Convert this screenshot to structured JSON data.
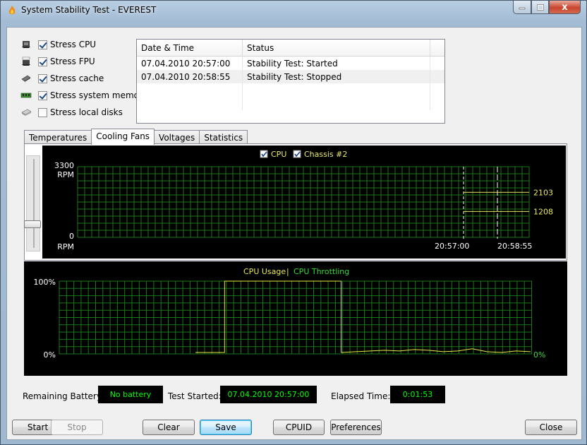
{
  "window": {
    "title": "System Stability Test - EVEREST",
    "close_glyph": "x"
  },
  "stress_options": [
    {
      "label": "Stress CPU",
      "checked": true,
      "icon": "cpu-icon"
    },
    {
      "label": "Stress FPU",
      "checked": true,
      "icon": "fpu-icon"
    },
    {
      "label": "Stress cache",
      "checked": true,
      "icon": "cache-icon"
    },
    {
      "label": "Stress system memory",
      "checked": true,
      "icon": "memory-icon"
    },
    {
      "label": "Stress local disks",
      "checked": false,
      "icon": "disk-icon"
    }
  ],
  "log": {
    "columns": [
      "Date & Time",
      "Status"
    ],
    "rows": [
      {
        "datetime": "07.04.2010 20:57:00",
        "status": "Stability Test: Started"
      },
      {
        "datetime": "07.04.2010 20:58:55",
        "status": "Stability Test: Stopped"
      }
    ]
  },
  "tabs": [
    {
      "label": "Temperatures",
      "active": false
    },
    {
      "label": "Cooling Fans",
      "active": true
    },
    {
      "label": "Voltages",
      "active": false
    },
    {
      "label": "Statistics",
      "active": false
    }
  ],
  "fan_chart": {
    "legend": [
      "CPU",
      "Chassis #2"
    ],
    "y_max_label": "3300",
    "y_min_label": "0",
    "unit": "RPM",
    "x_labels": [
      "20:57:00",
      "20:58:55"
    ],
    "value_labels": [
      "2103",
      "1208"
    ],
    "colors": {
      "grid": "#1a7a1a",
      "line": "#e8e86a",
      "text": "#ffffff",
      "value": "#e8e86a"
    }
  },
  "cpu_chart": {
    "legend_usage": "CPU Usage",
    "legend_sep": "|",
    "legend_throttling": "CPU Throttling",
    "y_max_label": "100%",
    "y_min_label": "0%",
    "throttle_value_label": "0%",
    "colors": {
      "grid": "#1a7a1a",
      "usage": "#e8e84a",
      "throttling": "#39d839"
    }
  },
  "chart_data": [
    {
      "type": "line",
      "title": "",
      "ylabel": "RPM",
      "ylim": [
        0,
        3300
      ],
      "x": [
        "20:57:00",
        "20:58:55"
      ],
      "series": [
        {
          "name": "CPU",
          "values": [
            2103,
            2103
          ]
        },
        {
          "name": "Chassis #2",
          "values": [
            1208,
            1208
          ]
        }
      ]
    },
    {
      "type": "line",
      "title": "",
      "ylim": [
        0,
        100
      ],
      "series": [
        {
          "name": "CPU Usage",
          "values": [
            2,
            2,
            100,
            100,
            100,
            100,
            100,
            100,
            100,
            100,
            2,
            3,
            4,
            5,
            4,
            6,
            5,
            3,
            4,
            7,
            3,
            2,
            4,
            3
          ]
        },
        {
          "name": "CPU Throttling",
          "values": [
            0,
            0,
            0,
            0,
            0,
            0,
            0,
            0,
            0,
            0,
            0,
            0,
            0,
            0,
            0,
            0,
            0,
            0,
            0,
            0,
            0,
            0,
            0,
            0
          ]
        }
      ]
    }
  ],
  "status": {
    "battery_label": "Remaining Battery:",
    "battery_value": "No battery",
    "started_label": "Test Started:",
    "started_value": "07.04.2010 20:57:00",
    "elapsed_label": "Elapsed Time:",
    "elapsed_value": "0:01:53"
  },
  "buttons": {
    "start": "Start",
    "stop": "Stop",
    "clear": "Clear",
    "save": "Save",
    "cpuid": "CPUID",
    "preferences": "Preferences",
    "close": "Close"
  }
}
